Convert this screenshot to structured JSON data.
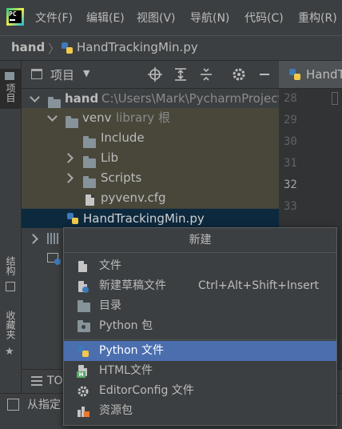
{
  "menubar": {
    "logo_text": "PC",
    "items": [
      "文件(F)",
      "编辑(E)",
      "视图(V)",
      "导航(N)",
      "代码(C)",
      "重构(R)"
    ]
  },
  "breadcrumb": {
    "root": "hand",
    "file": "HandTrackingMin.py"
  },
  "left_strip": {
    "project_tab": "项目",
    "structure_tab": "结构",
    "favorites_tab": "收藏夹"
  },
  "project_panel": {
    "title": "项目"
  },
  "tree": {
    "root_name": "hand",
    "root_path": "C:\\Users\\Mark\\PycharmProject",
    "venv_name": "venv",
    "venv_note": "library 根",
    "include": "Include",
    "lib": "Lib",
    "scripts": "Scripts",
    "pyvenv": "pyvenv.cfg",
    "main_file": "HandTrackingMin.py"
  },
  "editor": {
    "tab_label": "HandT",
    "line_numbers": [
      "28",
      "29",
      "30",
      "31",
      "32",
      "33"
    ],
    "current_line": "32"
  },
  "popup": {
    "title": "新建",
    "items": [
      {
        "label": "文件",
        "shortcut": "",
        "icon": "file-icon"
      },
      {
        "label": "新建草稿文件",
        "shortcut": "Ctrl+Alt+Shift+Insert",
        "icon": "scratch-file-icon"
      },
      {
        "label": "目录",
        "shortcut": "",
        "icon": "folder-icon"
      },
      {
        "label": "Python 包",
        "shortcut": "",
        "icon": "package-icon"
      },
      {
        "label": "Python 文件",
        "shortcut": "",
        "icon": "python-icon",
        "selected": true
      },
      {
        "label": "HTML文件",
        "shortcut": "",
        "icon": "html-icon"
      },
      {
        "label": "EditorConfig 文件",
        "shortcut": "",
        "icon": "gear-icon"
      },
      {
        "label": "资源包",
        "shortcut": "",
        "icon": "resource-bundle-icon"
      }
    ]
  },
  "bottom": {
    "todo_label": "TO",
    "status_text": "从指定"
  },
  "colors": {
    "selection": "#4b6eaf",
    "tree_row_highlight": "#0d293e",
    "venv_bg": "#49473a"
  }
}
